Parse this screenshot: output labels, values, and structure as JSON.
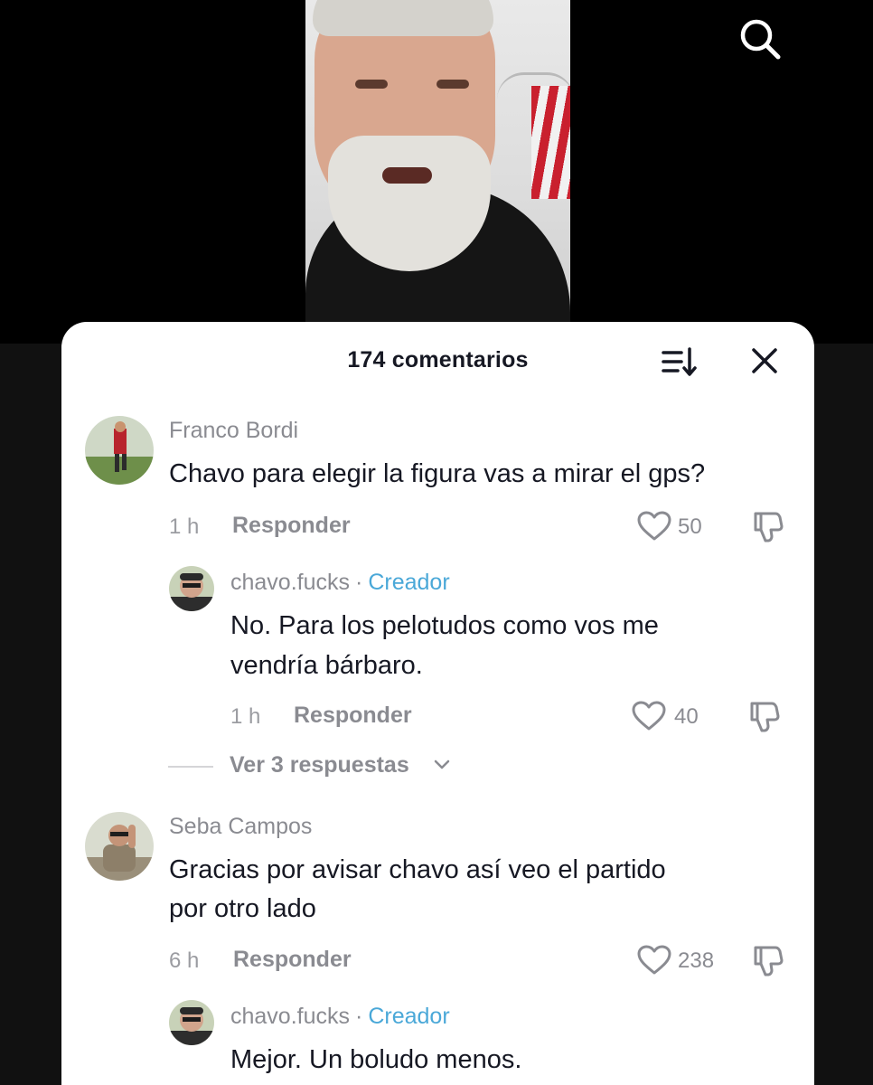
{
  "header": {
    "title": "174 comentarios"
  },
  "icons": {
    "search": "search-icon",
    "sort": "sort-icon",
    "close": "close-icon",
    "like": "heart-icon",
    "dislike": "thumbs-down-icon",
    "chevron": "chevron-down-icon"
  },
  "colors": {
    "creator": "#4aa8d8",
    "text": "#161823",
    "muted": "#8a8b91"
  },
  "comments": [
    {
      "username": "Franco Bordi",
      "text": "Chavo para elegir la figura vas a mirar el gps?",
      "time": "1 h",
      "reply_label": "Responder",
      "likes": "50",
      "reply": {
        "username": "chavo.fucks",
        "separator": "·",
        "badge": "Creador",
        "text_line1": "No. Para los pelotudos como vos me",
        "text_line2": "vendría bárbaro.",
        "time": "1 h",
        "reply_label": "Responder",
        "likes": "40"
      },
      "view_replies": "Ver 3 respuestas"
    },
    {
      "username": "Seba Campos",
      "text_line1": "Gracias por avisar chavo así veo el partido",
      "text_line2": "por otro lado",
      "time": "6 h",
      "reply_label": "Responder",
      "likes": "238",
      "reply": {
        "username": "chavo.fucks",
        "separator": "·",
        "badge": "Creador",
        "text": "Mejor. Un boludo menos."
      }
    }
  ]
}
